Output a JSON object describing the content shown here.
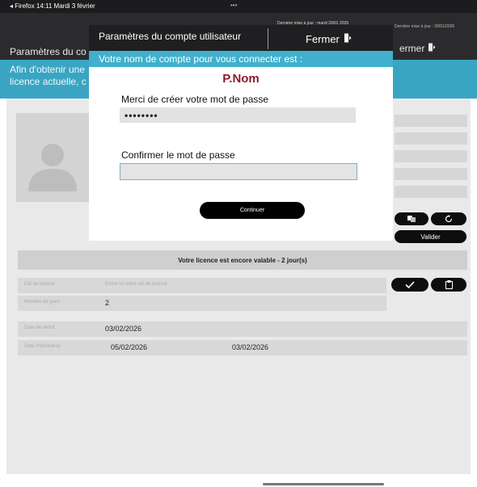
{
  "status_bar": {
    "left_text": "◂ Firefox   14:11   Mardi 3 février",
    "dots": "•••"
  },
  "background": {
    "title": "Paramètres du co",
    "last_update": "Dernière mise à jour : 28/01/2026",
    "close_label": "ermer",
    "notice": [
      "Afin d'obtenir une",
      "licence actuelle, c"
    ],
    "validate_label": "Valider",
    "licence_status": "Votre licence est encore valable - 2 jour(s)",
    "licence_key_label": "Clé de licence",
    "licence_key_placeholder": "Entrer ici votre clé de licence",
    "days_label": "Nombre de jours",
    "days_value": "2",
    "start_label": "Date de début",
    "start_value": "03/02/2026",
    "end_label": "Date d'échéance",
    "end_value": "05/02/2026",
    "end_value2": "03/02/2026"
  },
  "modal": {
    "title": "Paramètres du compte utilisateur",
    "last_update": "Dernière mise à jour : mardi 20/01 2026",
    "close_label": "Fermer",
    "account_intro": "Votre nom de compte pour vous connecter est :",
    "username": "P.Nom",
    "password_label": "Merci de créer votre mot de passe",
    "password_value": "••••••••",
    "confirm_label": "Confirmer le mot de passe",
    "confirm_value": "",
    "continue_label": "Continuer"
  },
  "colors": {
    "teal": "#40b0cc",
    "header": "#1f1f21",
    "username": "#8b1d2a"
  }
}
